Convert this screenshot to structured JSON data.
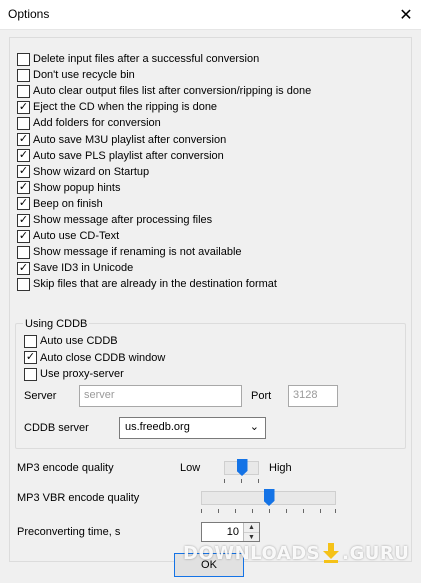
{
  "window": {
    "title": "Options"
  },
  "checkboxes": [
    {
      "label": "Delete input files after a successful conversion",
      "checked": false
    },
    {
      "label": "Don't use recycle bin",
      "checked": false
    },
    {
      "label": "Auto clear output files list after conversion/ripping is done",
      "checked": false
    },
    {
      "label": "Eject the CD when the ripping is done",
      "checked": true
    },
    {
      "label": "Add folders for conversion",
      "checked": false
    },
    {
      "label": "Auto save M3U playlist after conversion",
      "checked": true
    },
    {
      "label": "Auto save PLS playlist after conversion",
      "checked": true
    },
    {
      "label": "Show wizard on Startup",
      "checked": true
    },
    {
      "label": "Show popup hints",
      "checked": true
    },
    {
      "label": "Beep on finish",
      "checked": true
    },
    {
      "label": "Show message after processing files",
      "checked": true
    },
    {
      "label": "Auto use CD-Text",
      "checked": true
    },
    {
      "label": "Show message if renaming is not available",
      "checked": false
    },
    {
      "label": "Save ID3 in Unicode",
      "checked": true
    },
    {
      "label": "Skip files that are already in the destination format",
      "checked": false
    }
  ],
  "cddb": {
    "group_label": "Using CDDB",
    "options": [
      {
        "label": "Auto use CDDB",
        "checked": false
      },
      {
        "label": "Auto close CDDB window",
        "checked": true
      },
      {
        "label": "Use proxy-server",
        "checked": false
      }
    ],
    "server_label": "Server",
    "server_value": "server",
    "port_label": "Port",
    "port_value": "3128",
    "cddb_server_label": "CDDB server",
    "cddb_server_value": "us.freedb.org"
  },
  "encode": {
    "quality_label": "MP3 encode quality",
    "low_label": "Low",
    "high_label": "High",
    "quality_level": 0.5,
    "vbr_label": "MP3 VBR encode quality",
    "vbr_level": 0.5,
    "preconvert_label": "Preconverting time, s",
    "preconvert_value": "10"
  },
  "buttons": {
    "ok": "OK"
  },
  "watermark": {
    "left": "DOWNLOADS",
    "right": ".GURU"
  },
  "colors": {
    "accent": "#1473e6",
    "background": "#f0f0f0"
  }
}
